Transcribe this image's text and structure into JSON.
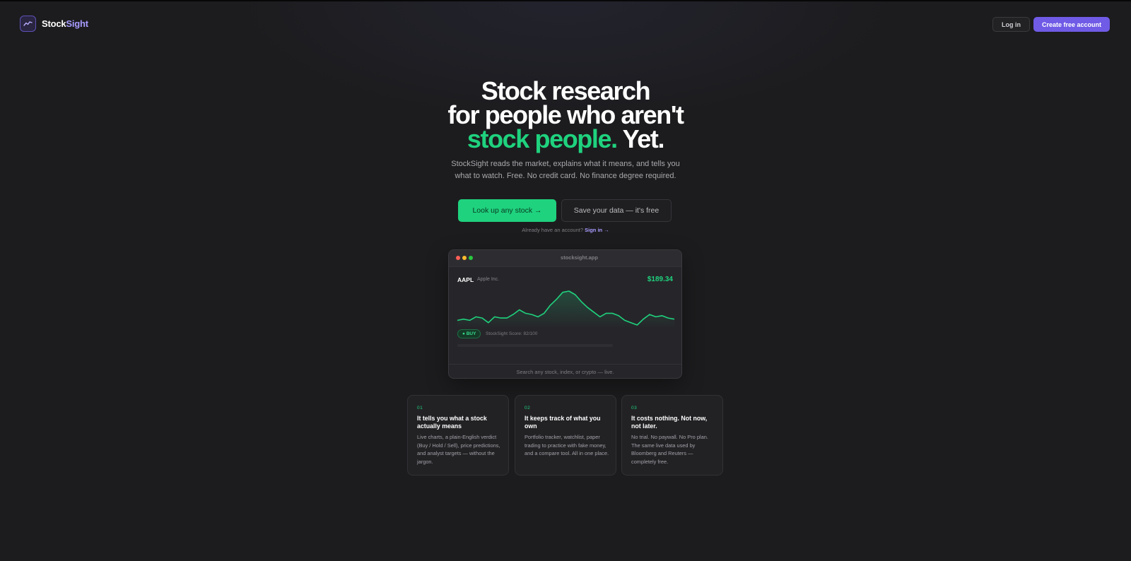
{
  "brand": {
    "name_a": "Stock",
    "name_b": "Sight"
  },
  "nav": {
    "login": "Log in",
    "create": "Create free account"
  },
  "hero": {
    "line1": "Stock research",
    "line2": "for people who aren't",
    "line3_green": "stock people.",
    "line3_rest": " Yet.",
    "sub1": "StockSight reads the market, explains what it means, and tells you",
    "sub2": "what to watch. Free. No credit card. No finance degree required."
  },
  "cta": {
    "primary": "Look up any stock →",
    "secondary": "Save your data — it's free",
    "already": "Already have an account? ",
    "signin": "Sign in →"
  },
  "mock": {
    "url": "stocksight.app",
    "ticker": "AAPL",
    "company": "Apple Inc.",
    "price": "$189.34",
    "badge": "● BUY",
    "score": "StockSight Score: 82/100",
    "footer": "Search any stock, index, or crypto — live."
  },
  "chart_data": {
    "type": "line",
    "values": [
      40,
      41,
      40,
      43,
      42,
      38,
      43,
      42,
      42,
      45,
      49,
      46,
      45,
      43,
      46,
      53,
      58,
      64,
      65,
      62,
      56,
      51,
      47,
      43,
      46,
      46,
      44,
      40,
      38,
      36,
      41,
      45,
      43,
      44,
      42,
      41
    ],
    "color": "#1fd27e"
  },
  "cards": [
    {
      "num": "01",
      "title": "It tells you what a stock actually means",
      "desc": "Live charts, a plain-English verdict (Buy / Hold / Sell), price predictions, and analyst targets — without the jargon."
    },
    {
      "num": "02",
      "title": "It keeps track of what you own",
      "desc": "Portfolio tracker, watchlist, paper trading to practice with fake money, and a compare tool. All in one place."
    },
    {
      "num": "03",
      "title": "It costs nothing. Not now, not later.",
      "desc": "No trial. No paywall. No Pro plan. The same live data used by Bloomberg and Reuters — completely free."
    }
  ],
  "colors": {
    "accent": "#1fd27e",
    "brand": "#6f5be6",
    "brand_light": "#a89cff",
    "bg": "#1c1c1e"
  }
}
